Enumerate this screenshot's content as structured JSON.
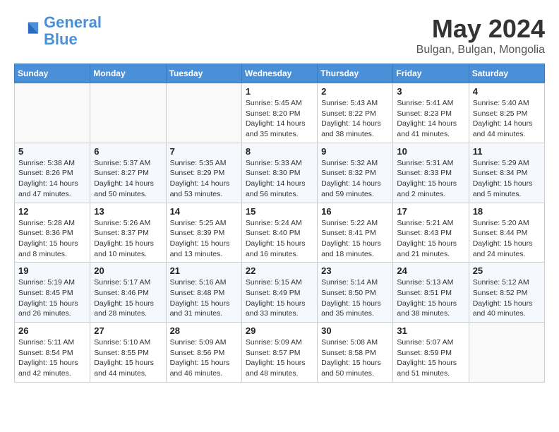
{
  "header": {
    "logo_line1": "General",
    "logo_line2": "Blue",
    "month": "May 2024",
    "location": "Bulgan, Bulgan, Mongolia"
  },
  "days_of_week": [
    "Sunday",
    "Monday",
    "Tuesday",
    "Wednesday",
    "Thursday",
    "Friday",
    "Saturday"
  ],
  "weeks": [
    [
      {
        "day": "",
        "info": ""
      },
      {
        "day": "",
        "info": ""
      },
      {
        "day": "",
        "info": ""
      },
      {
        "day": "1",
        "info": "Sunrise: 5:45 AM\nSunset: 8:20 PM\nDaylight: 14 hours\nand 35 minutes."
      },
      {
        "day": "2",
        "info": "Sunrise: 5:43 AM\nSunset: 8:22 PM\nDaylight: 14 hours\nand 38 minutes."
      },
      {
        "day": "3",
        "info": "Sunrise: 5:41 AM\nSunset: 8:23 PM\nDaylight: 14 hours\nand 41 minutes."
      },
      {
        "day": "4",
        "info": "Sunrise: 5:40 AM\nSunset: 8:25 PM\nDaylight: 14 hours\nand 44 minutes."
      }
    ],
    [
      {
        "day": "5",
        "info": "Sunrise: 5:38 AM\nSunset: 8:26 PM\nDaylight: 14 hours\nand 47 minutes."
      },
      {
        "day": "6",
        "info": "Sunrise: 5:37 AM\nSunset: 8:27 PM\nDaylight: 14 hours\nand 50 minutes."
      },
      {
        "day": "7",
        "info": "Sunrise: 5:35 AM\nSunset: 8:29 PM\nDaylight: 14 hours\nand 53 minutes."
      },
      {
        "day": "8",
        "info": "Sunrise: 5:33 AM\nSunset: 8:30 PM\nDaylight: 14 hours\nand 56 minutes."
      },
      {
        "day": "9",
        "info": "Sunrise: 5:32 AM\nSunset: 8:32 PM\nDaylight: 14 hours\nand 59 minutes."
      },
      {
        "day": "10",
        "info": "Sunrise: 5:31 AM\nSunset: 8:33 PM\nDaylight: 15 hours\nand 2 minutes."
      },
      {
        "day": "11",
        "info": "Sunrise: 5:29 AM\nSunset: 8:34 PM\nDaylight: 15 hours\nand 5 minutes."
      }
    ],
    [
      {
        "day": "12",
        "info": "Sunrise: 5:28 AM\nSunset: 8:36 PM\nDaylight: 15 hours\nand 8 minutes."
      },
      {
        "day": "13",
        "info": "Sunrise: 5:26 AM\nSunset: 8:37 PM\nDaylight: 15 hours\nand 10 minutes."
      },
      {
        "day": "14",
        "info": "Sunrise: 5:25 AM\nSunset: 8:39 PM\nDaylight: 15 hours\nand 13 minutes."
      },
      {
        "day": "15",
        "info": "Sunrise: 5:24 AM\nSunset: 8:40 PM\nDaylight: 15 hours\nand 16 minutes."
      },
      {
        "day": "16",
        "info": "Sunrise: 5:22 AM\nSunset: 8:41 PM\nDaylight: 15 hours\nand 18 minutes."
      },
      {
        "day": "17",
        "info": "Sunrise: 5:21 AM\nSunset: 8:43 PM\nDaylight: 15 hours\nand 21 minutes."
      },
      {
        "day": "18",
        "info": "Sunrise: 5:20 AM\nSunset: 8:44 PM\nDaylight: 15 hours\nand 24 minutes."
      }
    ],
    [
      {
        "day": "19",
        "info": "Sunrise: 5:19 AM\nSunset: 8:45 PM\nDaylight: 15 hours\nand 26 minutes."
      },
      {
        "day": "20",
        "info": "Sunrise: 5:17 AM\nSunset: 8:46 PM\nDaylight: 15 hours\nand 28 minutes."
      },
      {
        "day": "21",
        "info": "Sunrise: 5:16 AM\nSunset: 8:48 PM\nDaylight: 15 hours\nand 31 minutes."
      },
      {
        "day": "22",
        "info": "Sunrise: 5:15 AM\nSunset: 8:49 PM\nDaylight: 15 hours\nand 33 minutes."
      },
      {
        "day": "23",
        "info": "Sunrise: 5:14 AM\nSunset: 8:50 PM\nDaylight: 15 hours\nand 35 minutes."
      },
      {
        "day": "24",
        "info": "Sunrise: 5:13 AM\nSunset: 8:51 PM\nDaylight: 15 hours\nand 38 minutes."
      },
      {
        "day": "25",
        "info": "Sunrise: 5:12 AM\nSunset: 8:52 PM\nDaylight: 15 hours\nand 40 minutes."
      }
    ],
    [
      {
        "day": "26",
        "info": "Sunrise: 5:11 AM\nSunset: 8:54 PM\nDaylight: 15 hours\nand 42 minutes."
      },
      {
        "day": "27",
        "info": "Sunrise: 5:10 AM\nSunset: 8:55 PM\nDaylight: 15 hours\nand 44 minutes."
      },
      {
        "day": "28",
        "info": "Sunrise: 5:09 AM\nSunset: 8:56 PM\nDaylight: 15 hours\nand 46 minutes."
      },
      {
        "day": "29",
        "info": "Sunrise: 5:09 AM\nSunset: 8:57 PM\nDaylight: 15 hours\nand 48 minutes."
      },
      {
        "day": "30",
        "info": "Sunrise: 5:08 AM\nSunset: 8:58 PM\nDaylight: 15 hours\nand 50 minutes."
      },
      {
        "day": "31",
        "info": "Sunrise: 5:07 AM\nSunset: 8:59 PM\nDaylight: 15 hours\nand 51 minutes."
      },
      {
        "day": "",
        "info": ""
      }
    ]
  ]
}
